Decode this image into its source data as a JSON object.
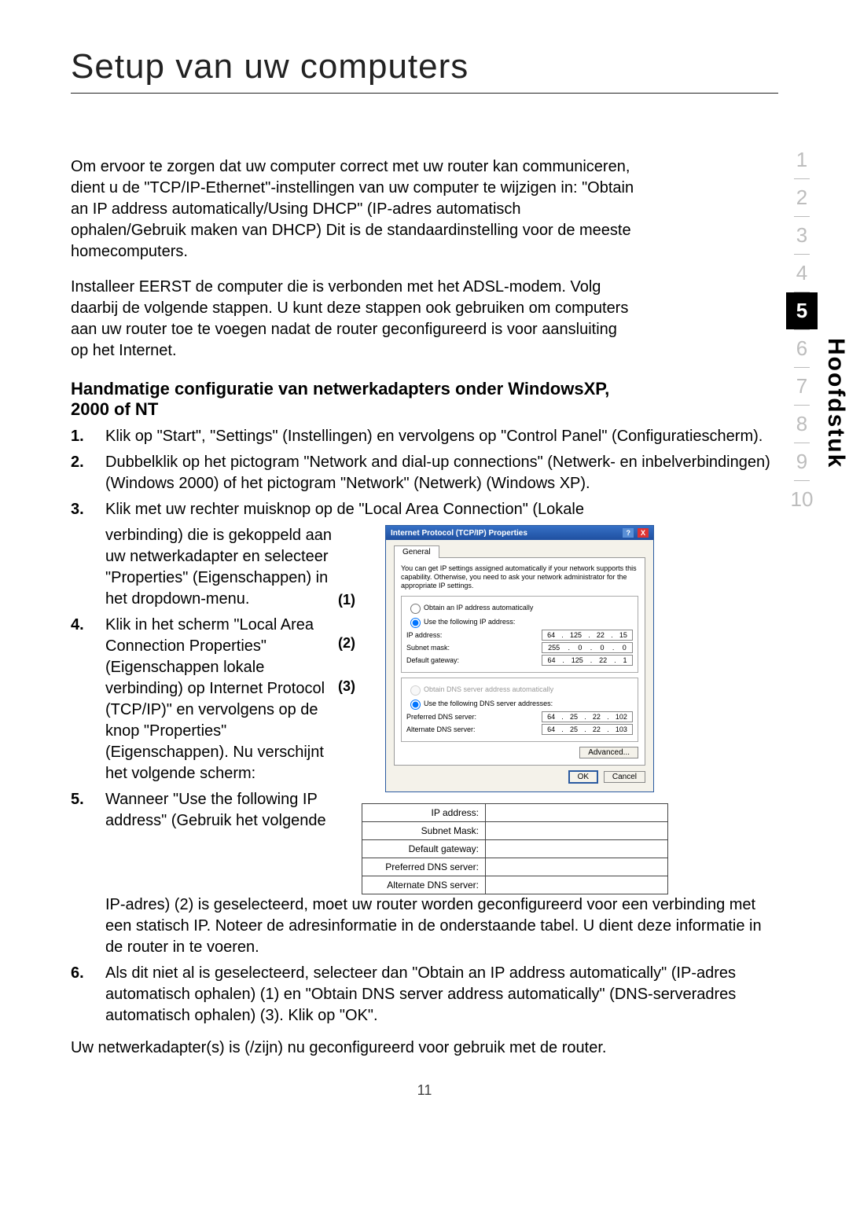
{
  "title": "Setup van uw computers",
  "intro1": "Om ervoor te zorgen dat uw computer correct met uw router kan communiceren, dient u de \"TCP/IP-Ethernet\"-instellingen van uw computer te wijzigen in: \"Obtain an IP address automatically/Using DHCP\" (IP-adres automatisch ophalen/Gebruik maken van DHCP) Dit is de standaardinstelling voor de meeste homecomputers.",
  "intro2": "Installeer EERST de computer die is verbonden met het ADSL-modem. Volg daarbij de volgende stappen. U kunt deze stappen ook gebruiken om computers aan uw router toe te voegen nadat de router geconfigureerd is voor aansluiting op het Internet.",
  "subhead": "Handmatige configuratie van netwerkadapters onder WindowsXP, 2000 of NT",
  "steps": {
    "s1": "Klik op \"Start\", \"Settings\" (Instellingen) en vervolgens op \"Control Panel\" (Configuratiescherm).",
    "s2": "Dubbelklik op het pictogram \"Network and dial-up connections\" (Netwerk- en inbelverbindingen) (Windows 2000) of het pictogram \"Network\" (Netwerk) (Windows XP).",
    "s3a": "Klik met uw rechter muisknop op de \"Local Area Connection\" (Lokale",
    "s3b": "verbinding) die is gekoppeld aan uw netwerkadapter en selecteer \"Properties\" (Eigenschappen) in het dropdown-menu.",
    "s4": "Klik in het scherm \"Local Area Connection Properties\" (Eigenschappen lokale verbinding) op Internet      Protocol (TCP/IP)\" en vervolgens op de knop \"Properties\" (Eigenschappen). Nu verschijnt het volgende scherm:",
    "s5a": "Wanneer \"Use the following IP address\" (Gebruik het volgende",
    "s5b": "IP-adres) (2) is geselecteerd, moet uw router worden geconfigureerd voor een verbinding met een statisch IP. Noteer de adresinformatie in de onderstaande tabel. U dient deze informatie in de router in te voeren.",
    "s6": "Als dit niet al is geselecteerd, selecteer dan \"Obtain an IP address automatically\" (IP-adres automatisch ophalen) (1) en \"Obtain DNS server address automatically\" (DNS-serveradres automatisch ophalen) (3). Klik op \"OK\"."
  },
  "closing": "Uw netwerkadapter(s) is (/zijn) nu geconfigureerd voor gebruik met de router.",
  "callouts": {
    "c1": "(1)",
    "c2": "(2)",
    "c3": "(3)"
  },
  "dialog": {
    "title": "Internet Protocol (TCP/IP) Properties",
    "tab": "General",
    "note": "You can get IP settings assigned automatically if your network supports this capability. Otherwise, you need to ask your network administrator for the appropriate IP settings.",
    "r_auto_ip": "Obtain an IP address automatically",
    "r_use_ip": "Use the following IP address:",
    "l_ip": "IP address:",
    "l_mask": "Subnet mask:",
    "l_gw": "Default gateway:",
    "r_auto_dns": "Obtain DNS server address automatically",
    "r_use_dns": "Use the following DNS server addresses:",
    "l_pdns": "Preferred DNS server:",
    "l_adns": "Alternate DNS server:",
    "ip": [
      "64",
      "125",
      "22",
      "15"
    ],
    "mask": [
      "255",
      "0",
      "0",
      "0"
    ],
    "gw": [
      "64",
      "125",
      "22",
      "1"
    ],
    "pdns": [
      "64",
      "25",
      "22",
      "102"
    ],
    "adns": [
      "64",
      "25",
      "22",
      "103"
    ],
    "btn_adv": "Advanced...",
    "btn_ok": "OK",
    "btn_cancel": "Cancel"
  },
  "blank_table": {
    "ip": "IP address:",
    "mask": "Subnet Mask:",
    "gw": "Default gateway:",
    "pdns": "Preferred DNS server:",
    "adns": "Alternate DNS server:"
  },
  "page_number": "11",
  "vlabel": "Hoofdstuk",
  "chapters": [
    "1",
    "2",
    "3",
    "4",
    "5",
    "6",
    "7",
    "8",
    "9",
    "10"
  ],
  "active_chapter": "5"
}
